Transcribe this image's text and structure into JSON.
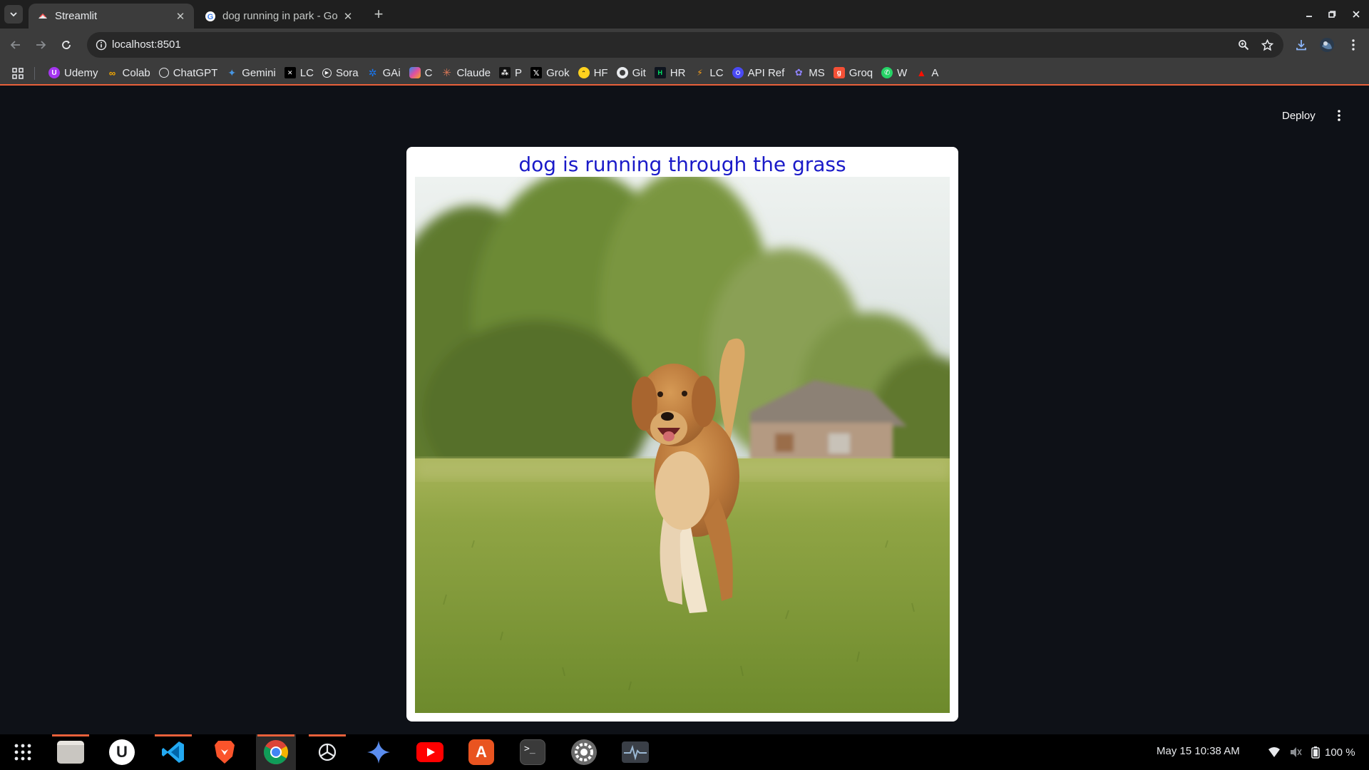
{
  "browser": {
    "tabs": [
      {
        "title": "Streamlit",
        "active": true
      },
      {
        "title": "dog running in park - Go",
        "active": false
      }
    ],
    "url": "localhost:8501",
    "bookmarks": [
      {
        "label": "Udemy",
        "icon": "udemy-icon",
        "color": "#a435f0"
      },
      {
        "label": "Colab",
        "icon": "colab-icon",
        "color": "#f9ab00"
      },
      {
        "label": "ChatGPT",
        "icon": "chatgpt-icon",
        "color": "#ffffff"
      },
      {
        "label": "Gemini",
        "icon": "gemini-icon",
        "color": "#4796e3"
      },
      {
        "label": "LC",
        "icon": "leetcode-icon",
        "color": "#ffffff"
      },
      {
        "label": "Sora",
        "icon": "sora-icon",
        "color": "#ffffff"
      },
      {
        "label": "GAi",
        "icon": "gai-icon",
        "color": "#1877f2"
      },
      {
        "label": "C",
        "icon": "copilot-icon",
        "color": "#e04fa0"
      },
      {
        "label": "Claude",
        "icon": "claude-icon",
        "color": "#d97757"
      },
      {
        "label": "P",
        "icon": "perplexity-icon",
        "color": "#ffffff"
      },
      {
        "label": "Grok",
        "icon": "grok-icon",
        "color": "#ffffff"
      },
      {
        "label": "HF",
        "icon": "huggingface-icon",
        "color": "#ffd21e"
      },
      {
        "label": "Git",
        "icon": "github-icon",
        "color": "#ffffff"
      },
      {
        "label": "HR",
        "icon": "hackerrank-icon",
        "color": "#00ea64"
      },
      {
        "label": "LC",
        "icon": "langchain-icon",
        "color": "#f89f1b"
      },
      {
        "label": "API Ref",
        "icon": "api-ref-icon",
        "color": "#4a4af4"
      },
      {
        "label": "MS",
        "icon": "ms-icon",
        "color": "#6b5cff"
      },
      {
        "label": "Groq",
        "icon": "groq-icon",
        "color": "#f55036"
      },
      {
        "label": "W",
        "icon": "whatsapp-icon",
        "color": "#25d366"
      },
      {
        "label": "A",
        "icon": "adobe-icon",
        "color": "#fa0f00"
      }
    ]
  },
  "app": {
    "deploy_label": "Deploy",
    "caption": "dog is running through the grass",
    "image_subject": "golden retriever running on grass in a park"
  },
  "taskbar": {
    "apps": [
      {
        "name": "apps-grid-icon",
        "running": false
      },
      {
        "name": "files-icon",
        "running": true
      },
      {
        "name": "udemy-app-icon",
        "running": false
      },
      {
        "name": "vscode-icon",
        "running": true
      },
      {
        "name": "brave-icon",
        "running": false
      },
      {
        "name": "chrome-icon",
        "running": true,
        "focused": true
      },
      {
        "name": "chatgpt-app-icon",
        "running": true
      },
      {
        "name": "gemini-app-icon",
        "running": false
      },
      {
        "name": "youtube-icon",
        "running": false
      },
      {
        "name": "app-center-icon",
        "running": false
      },
      {
        "name": "terminal-icon",
        "running": false
      },
      {
        "name": "settings-icon",
        "running": false
      },
      {
        "name": "system-monitor-icon",
        "running": false
      }
    ],
    "clock": "May 15  10:38 AM",
    "battery": "100 %"
  },
  "colors": {
    "page_bg": "#0e1117",
    "accent": "#e8603a",
    "caption_text": "#1a1ac8"
  }
}
